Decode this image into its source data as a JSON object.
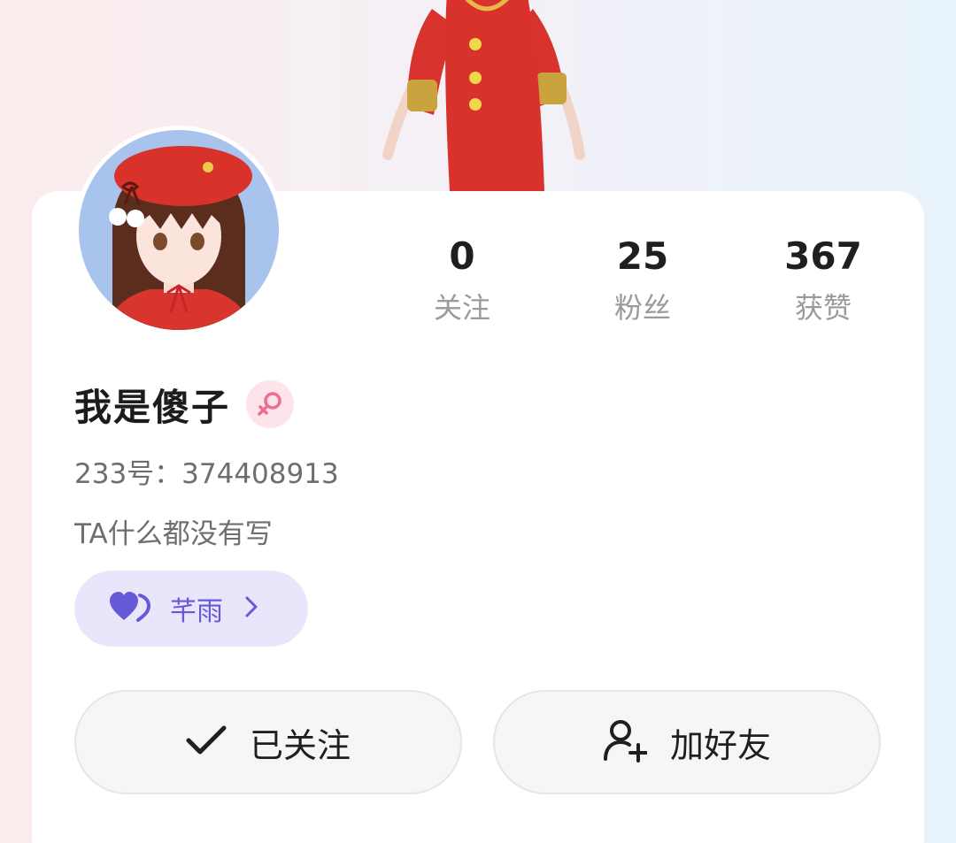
{
  "profile": {
    "name": "我是傻子",
    "uid": "233号：374408913",
    "bio": "TA什么都没有写",
    "gender_icon": "female-icon"
  },
  "stats": [
    {
      "value": "0",
      "label": "关注"
    },
    {
      "value": "25",
      "label": "粉丝"
    },
    {
      "value": "367",
      "label": "获赞"
    }
  ],
  "partner": {
    "icon": "heart-pair-icon",
    "label": "芊雨",
    "chevron": "chevron-right-icon"
  },
  "actions": {
    "follow": {
      "icon": "check-icon",
      "label": "已关注"
    },
    "add_friend": {
      "icon": "add-user-icon",
      "label": "加好友"
    }
  },
  "colors": {
    "accent_purple": "#6659d8",
    "partner_bg": "#e9e6fb",
    "gender_pink": "#ef6d92"
  }
}
